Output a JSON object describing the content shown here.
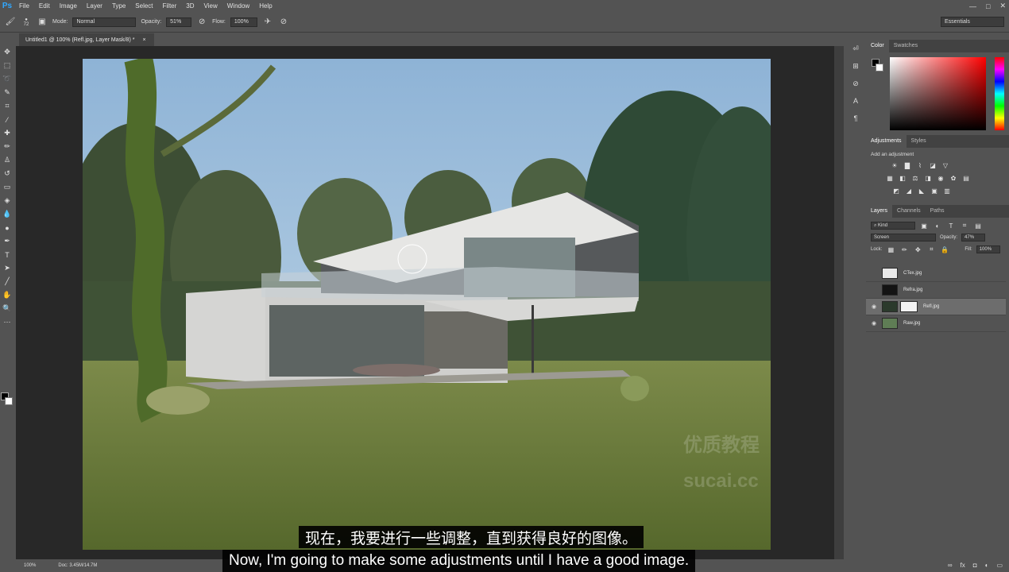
{
  "menubar": {
    "logo": "Ps",
    "items": [
      "File",
      "Edit",
      "Image",
      "Layer",
      "Type",
      "Select",
      "Filter",
      "3D",
      "View",
      "Window",
      "Help"
    ],
    "win_min": "—",
    "win_max": "□",
    "win_close": "✕"
  },
  "options": {
    "brush_size": "72",
    "mode_label": "Mode:",
    "mode_value": "Normal",
    "opacity_label": "Opacity:",
    "opacity_value": "51%",
    "flow_label": "Flow:",
    "flow_value": "100%",
    "workspace": "Essentials"
  },
  "document": {
    "tab_title": "Untitled1 @ 100% (Refl.jpg, Layer Mask/8) *",
    "tab_close": "×"
  },
  "status": {
    "zoom": "100%",
    "doc_size": "Doc: 3.45M/14.7M"
  },
  "color_panel": {
    "tabs": [
      "Color",
      "Swatches"
    ],
    "fg_color": "#000000",
    "bg_color": "#ffffff"
  },
  "adjustments_panel": {
    "tabs": [
      "Adjustments",
      "Styles"
    ],
    "title": "Add an adjustment"
  },
  "layers_panel": {
    "tabs": [
      "Layers",
      "Channels",
      "Paths"
    ],
    "kind_filter": "Kind",
    "blend_mode": "Screen",
    "opacity_label": "Opacity:",
    "opacity_value": "47%",
    "lock_label": "Lock:",
    "fill_label": "Fill:",
    "fill_value": "100%",
    "layers": [
      {
        "name": "CTex.jpg",
        "visible": false,
        "selected": false,
        "thumb": "#e8e8e8"
      },
      {
        "name": "Refra.jpg",
        "visible": false,
        "selected": false,
        "thumb": "#141414"
      },
      {
        "name": "Refl.jpg",
        "visible": true,
        "selected": true,
        "thumb": "#2b3a2c"
      },
      {
        "name": "Raw.jpg",
        "visible": true,
        "selected": false,
        "thumb": "#5f7d55"
      }
    ]
  },
  "subtitles": {
    "chinese": "现在，我要进行一些调整，直到获得良好的图像。",
    "english": "Now, I'm going to make some adjustments until I have a good image."
  },
  "watermark": {
    "line1": "优质教程",
    "line2": "sucai.cc"
  }
}
